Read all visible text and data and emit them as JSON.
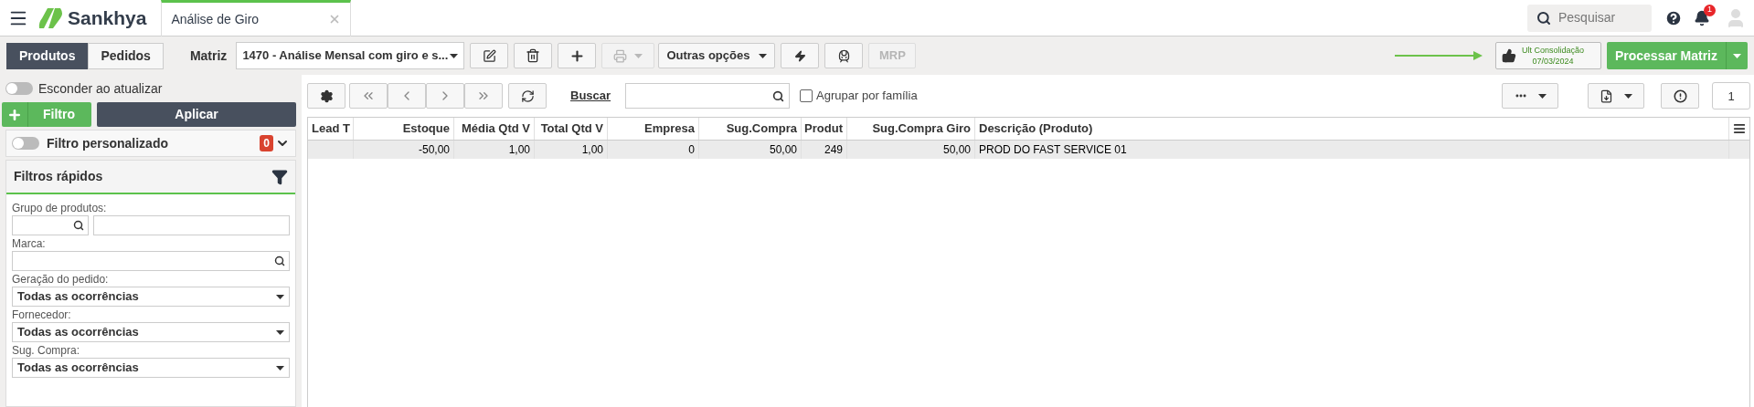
{
  "header": {
    "brand": "Sankhya",
    "tab": {
      "title": "Análise de Giro",
      "selected": true
    },
    "search": {
      "placeholder": "Pesquisar"
    },
    "notifications": "1"
  },
  "toolbar": {
    "tabs": [
      {
        "label": "Produtos",
        "selected": true
      },
      {
        "label": "Pedidos",
        "selected": false
      }
    ],
    "matrix_label": "Matriz",
    "matrix_value": "1470 - Análise Mensal com giro e s...",
    "print_disabled": true,
    "other_options": "Outras opções",
    "mrp": {
      "label": "MRP",
      "disabled": true
    },
    "consolidation_label": "Ult Consolidação",
    "consolidation_date": "07/03/2024",
    "process_button": "Processar Matriz"
  },
  "sidebar": {
    "hide_on_update": {
      "label": "Esconder ao atualizar",
      "on": false
    },
    "filter_button": "Filtro",
    "apply_button": "Aplicar",
    "custom_filter": {
      "label": "Filtro personalizado",
      "on": false,
      "count": "0"
    },
    "quick_filters": {
      "title": "Filtros rápidos",
      "fields": [
        {
          "kind": "lookup2",
          "label": "Grupo de produtos:"
        },
        {
          "kind": "lookup",
          "label": "Marca:"
        },
        {
          "kind": "select",
          "label": "Geração do pedido:",
          "value": "Todas as ocorrências"
        },
        {
          "kind": "select",
          "label": "Fornecedor:",
          "value": "Todas as ocorrências"
        },
        {
          "kind": "select",
          "label": "Sug. Compra:",
          "value": "Todas as ocorrências"
        }
      ]
    }
  },
  "grid_toolbar": {
    "search_link": "Buscar",
    "group_by_family": {
      "label": "Agrupar por família",
      "checked": false
    },
    "page": "1"
  },
  "table": {
    "columns": [
      "Lead T",
      "Estoque",
      "Média Qtd V",
      "Total Qtd V",
      "Empresa",
      "Sug.Compra",
      "Produt",
      "Sug.Compra Giro",
      "Descrição (Produto)"
    ],
    "rows": [
      {
        "selected": true,
        "cells": [
          "",
          "-50,00",
          "1,00",
          "1,00",
          "0",
          "50,00",
          "249",
          "50,00",
          "PROD DO FAST SERVICE 01"
        ]
      }
    ]
  }
}
